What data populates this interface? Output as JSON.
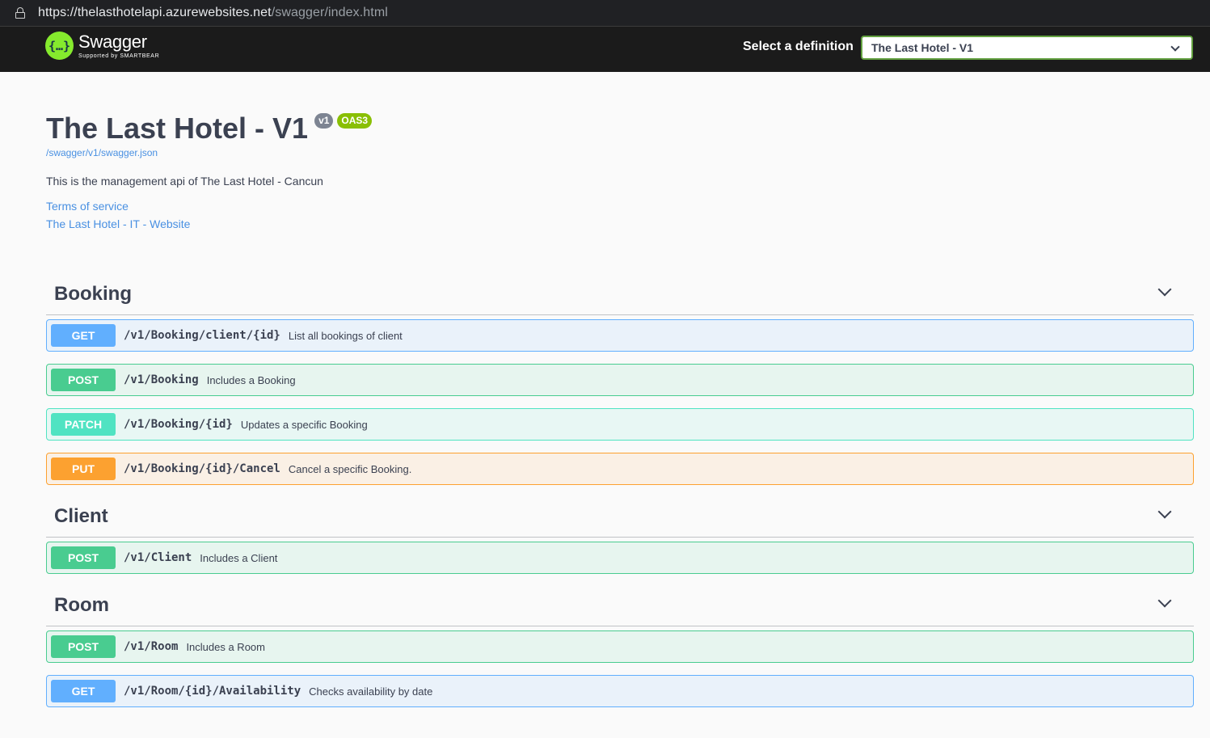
{
  "browser": {
    "url_host": "https://thelasthotelapi.azurewebsites.net",
    "url_path": "/swagger/index.html"
  },
  "topbar": {
    "logo_name": "Swagger",
    "logo_sub": "Supported by SMARTBEAR",
    "definition_label": "Select a definition",
    "definition_selected": "The Last Hotel - V1"
  },
  "info": {
    "title": "The Last Hotel - V1",
    "version_badge": "v1",
    "oas_badge": "OAS3",
    "spec_url": "/swagger/v1/swagger.json",
    "description": "This is the management api of The Last Hotel - Cancun",
    "terms_link": "Terms of service",
    "website_link": "The Last Hotel - IT - Website"
  },
  "sections": [
    {
      "name": "Booking",
      "operations": [
        {
          "method": "GET",
          "path": "/v1/Booking/client/{id}",
          "summary": "List all bookings of client"
        },
        {
          "method": "POST",
          "path": "/v1/Booking",
          "summary": "Includes a Booking"
        },
        {
          "method": "PATCH",
          "path": "/v1/Booking/{id}",
          "summary": "Updates a specific Booking"
        },
        {
          "method": "PUT",
          "path": "/v1/Booking/{id}/Cancel",
          "summary": "Cancel a specific Booking."
        }
      ]
    },
    {
      "name": "Client",
      "operations": [
        {
          "method": "POST",
          "path": "/v1/Client",
          "summary": "Includes a Client"
        }
      ]
    },
    {
      "name": "Room",
      "operations": [
        {
          "method": "POST",
          "path": "/v1/Room",
          "summary": "Includes a Room"
        },
        {
          "method": "GET",
          "path": "/v1/Room/{id}/Availability",
          "summary": "Checks availability by date"
        }
      ]
    }
  ],
  "colors": {
    "get": "#61affe",
    "post": "#49cc90",
    "patch": "#50e3c2",
    "put": "#fca130",
    "link": "#4990e2",
    "logo": "#85ea2d"
  }
}
